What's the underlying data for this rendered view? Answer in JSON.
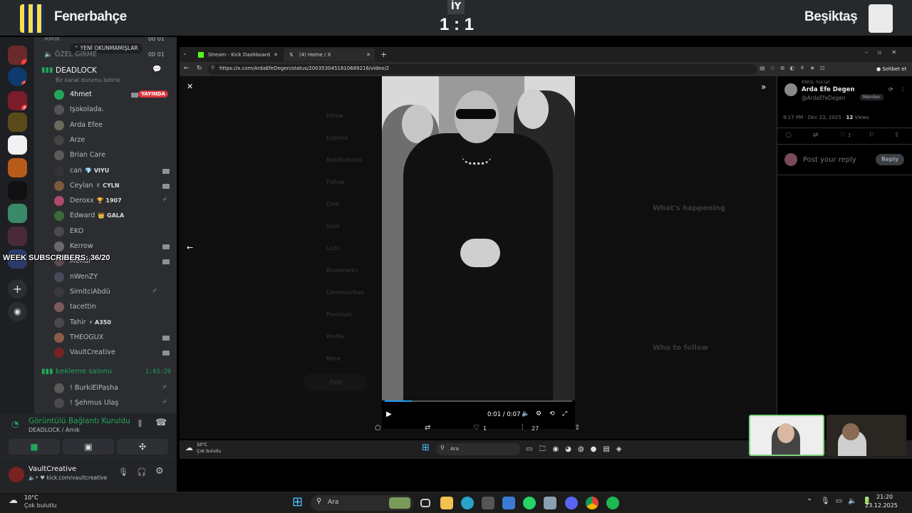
{
  "scoreboard": {
    "home_team": "Fenerbahçe",
    "away_team": "Beşiktaş",
    "period": "İY",
    "score": "1 : 1"
  },
  "discord": {
    "top_channels": [
      {
        "label": "AMİK",
        "count_a": "00",
        "count_b": "01"
      },
      {
        "label": "ÖZEL GİRME",
        "count_a": "00",
        "count_b": "01"
      }
    ],
    "unread_pill": "YENİ OKUNMAMIŞLAR",
    "voice_channel": {
      "name": "DEADLOCK",
      "status_placeholder": "Bir kanal durumu belirle",
      "members": [
        {
          "name": "4hmet",
          "live": "YAYINDA"
        },
        {
          "name": "Işokolada.",
          "tag": ""
        },
        {
          "name": "Arda Efee",
          "tag": ""
        },
        {
          "name": "Arze",
          "tag": ""
        },
        {
          "name": "Brian Care",
          "tag": ""
        },
        {
          "name": "can",
          "tag": "💎 VIYU"
        },
        {
          "name": "Ceylan",
          "tag": "✌ CYLN"
        },
        {
          "name": "Deroxx",
          "tag": "🏆 1907"
        },
        {
          "name": "Edward",
          "tag": "👑 GALA"
        },
        {
          "name": "EKO",
          "tag": ""
        },
        {
          "name": "Kerrow",
          "tag": ""
        },
        {
          "name": "Mehdi",
          "tag": ""
        },
        {
          "name": "nWenZY",
          "tag": ""
        },
        {
          "name": "SimitciAbdü",
          "tag": ""
        },
        {
          "name": "tacettin",
          "tag": ""
        },
        {
          "name": "Tahir",
          "tag": "⚡ A350"
        },
        {
          "name": "THEOGUX",
          "tag": ""
        },
        {
          "name": "VaultCreative",
          "tag": ""
        }
      ]
    },
    "waiting_channel": {
      "name": "bekleme salonu",
      "timer": "1:03:29",
      "members": [
        "! BurkiElPasha",
        "! Şehmus Ulaş"
      ]
    },
    "overlay_text": "WEEK SUBSCRIBERS: 36/20",
    "connection": {
      "status": "Görüntülü Bağlantı Kuruldu",
      "location": "DEADLOCK / Amik"
    },
    "user": {
      "name": "VaultCreative",
      "status": "kick.com/vaultcreative"
    }
  },
  "browser": {
    "tabs": [
      {
        "label": "Stream - Kick Dashboard"
      },
      {
        "label": "(4) Home / X"
      }
    ],
    "new_tab": "+",
    "url": "https://x.com/ArdaEfeDegen/status/2003530451810689216/video/2",
    "profile_btn": "Sohbet et",
    "video": {
      "time": "0:01 / 0:07",
      "replies": "",
      "reposts": "",
      "likes": "1",
      "views": "27"
    },
    "post": {
      "source_label": "KNGL Social",
      "author": "Arda Efe Degen",
      "handle": "@ArdaEfeDegen",
      "badge": "Member",
      "timestamp": "9:17 PM · Dec 23, 2025 · ",
      "views_count": "12",
      "views_label": " Views",
      "like_count": "1",
      "reply_placeholder": "Post your reply",
      "reply_button": "Reply"
    },
    "bg_sidebar": [
      "Home",
      "Explore",
      "Notifications",
      "Follow",
      "Chat",
      "Grok",
      "Lists",
      "Bookmarks",
      "Communities",
      "Premium",
      "Profile",
      "More"
    ],
    "bg_right": [
      "What's happening",
      "Who to follow"
    ],
    "bg_post_btn": "Post"
  },
  "inner_taskbar": {
    "weather_temp": "10°C",
    "weather_desc": "Çok bulutlu",
    "search": "Ara"
  },
  "taskbar": {
    "weather_temp": "10°C",
    "weather_desc": "Çok bulutlu",
    "search": "Ara",
    "time": "21:20",
    "date": "23.12.2025"
  },
  "colors": {
    "discord_green": "#23a55a",
    "live_red": "#da373c",
    "x_blue": "#1d9bf0"
  }
}
